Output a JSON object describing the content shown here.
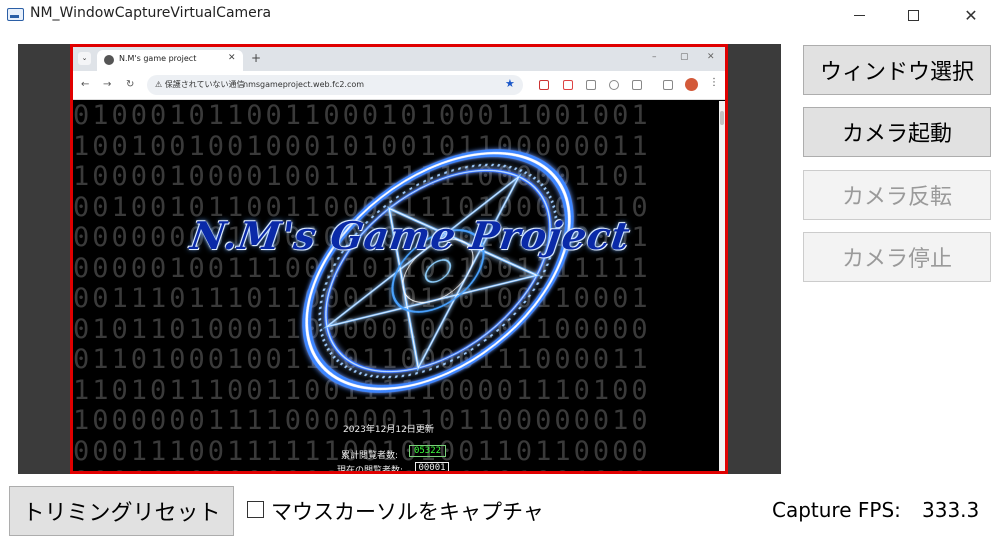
{
  "window": {
    "title": "NM_WindowCaptureVirtualCamera",
    "minimize_icon": "minimize-icon",
    "maximize_icon": "maximize-icon",
    "close_icon": "close-icon",
    "close_glyph": "✕"
  },
  "buttons": {
    "select_window": "ウィンドウ選択",
    "start_camera": "カメラ起動",
    "flip_camera": "カメラ反転",
    "stop_camera": "カメラ停止",
    "reset_trimming": "トリミングリセット"
  },
  "options": {
    "capture_cursor_label": "マウスカーソルをキャプチャ",
    "capture_cursor_checked": false
  },
  "status": {
    "fps_label": "Capture FPS:",
    "fps_value": "333.3"
  },
  "captured_browser": {
    "tab_title": "N.M's game project",
    "tab_close": "✕",
    "new_tab": "+",
    "security_text": "⚠ 保護されていない通信",
    "url": "nmsgameproject.web.fc2.com",
    "page": {
      "logo_text": "N.M's Game Project",
      "updated_text": "2023年12月12日更新",
      "total_visitors_label": "累計閲覧者数:",
      "total_visitors_value": "05322",
      "current_visitors_label": "現在の閲覧者数:",
      "current_visitors_value": "00001"
    }
  },
  "colors": {
    "capture_border": "#e00000",
    "preview_background": "#3b3b3b",
    "button_face": "#e1e1e1",
    "button_disabled_text": "#9a9a9a"
  }
}
